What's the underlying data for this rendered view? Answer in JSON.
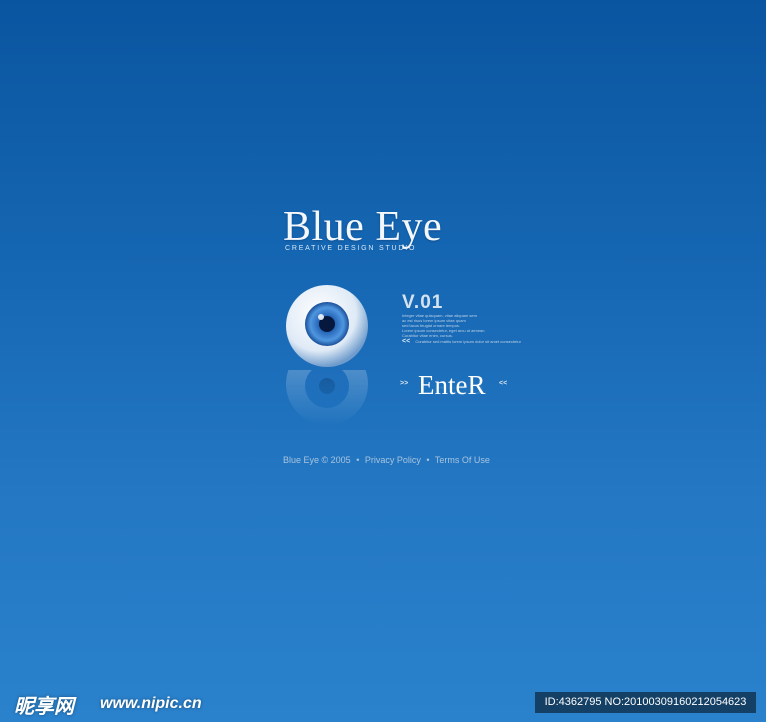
{
  "brand": {
    "title": "Blue Eye",
    "subtitle": "CREATIVE DESIGN STUDIO"
  },
  "intro": {
    "version": "V.01",
    "desc_lines": [
      "Integer vitae quisquam, vitae aliquam sem",
      "ac est risus lorem ipsum vitae quam",
      "sed lacus feugiat ornare tempus."
    ],
    "desc_lines_2": [
      "Lorem ipsum consectetur, eget arcu ut aenean",
      "Curabitur vitae enim, cursus."
    ],
    "news_arrows": "<<",
    "news_text": "Curabitur sed mattis lorem ipsum dolor sit amet consectetur"
  },
  "enter": {
    "label": "EnteR",
    "arrow_left": ">>",
    "arrow_right": "<<"
  },
  "footer": {
    "copyright": "Blue Eye © 2005",
    "separator": "•",
    "privacy": "Privacy Policy",
    "terms": "Terms Of Use"
  },
  "watermark": {
    "logo": "昵享网",
    "url": "www.nipic.cn",
    "id": "ID:4362795 NO:20100309160212054623"
  },
  "colors": {
    "background_top": "#0a55a0",
    "background_bottom": "#2a82cc",
    "iris": "#2a6fc0",
    "text_light": "#f4f8fc"
  },
  "icons": {
    "eye": "eye-icon"
  }
}
